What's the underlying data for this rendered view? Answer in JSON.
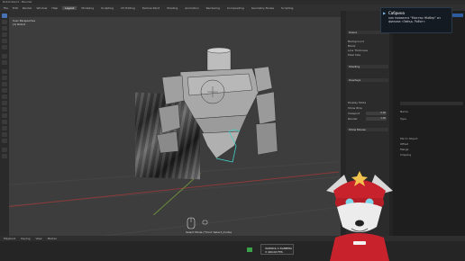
{
  "window": {
    "title": "Robot.blend - Blender"
  },
  "menu": {
    "items": [
      "File",
      "Edit",
      "Render",
      "Window",
      "Help"
    ],
    "tabs": [
      "Layout",
      "Modeling",
      "Sculpting",
      "UV Editing",
      "Texture Paint",
      "Shading",
      "Animation",
      "Rendering",
      "Compositing",
      "Geometry Nodes",
      "Scripting"
    ],
    "active_tab": "Layout"
  },
  "viewport": {
    "info_line1": "User Perspective",
    "info_line2": "(1) Robot",
    "status_text": "Select Mode (*mod: Select_mode)"
  },
  "properties": {
    "header": "Scene",
    "sections": [
      {
        "label": "Background",
        "value": ""
      },
      {
        "label": "Blank",
        "value": ""
      },
      {
        "label": "Line Thickness",
        "value": ""
      },
      {
        "label": "Pixel Size",
        "value": ""
      },
      {
        "label": "Shading",
        "value": ""
      },
      {
        "label": "Overlays",
        "value": ""
      },
      {
        "label": "Display Mode",
        "value": ""
      },
      {
        "label": "Show Wire",
        "value": ""
      },
      {
        "label": "Viewport",
        "value": "0.00"
      },
      {
        "label": "Render",
        "value": "1.00"
      },
      {
        "label": "Show Mouse",
        "value": ""
      }
    ]
  },
  "far_panel": {
    "rows": [
      "Name",
      "Type",
      "Mirror Object",
      "Offset",
      "Merge",
      "Clipping"
    ]
  },
  "notification": {
    "icon": "play-icon",
    "title": "Сабрина",
    "body": "как появился \"Мистер Жобер\" из фильма «Звёзд. Робот»"
  },
  "timeline": {
    "menu": [
      "Playback",
      "Keying",
      "View",
      "Marker"
    ],
    "frame_top": "ЗАПИСЬ С КАМЕРЫ",
    "frame_bottom": "3 400.00 FPS"
  },
  "colors": {
    "accent": "#4772b3",
    "selection_outline": "#3fd0c9",
    "notification_bg": "#141a22",
    "record_green": "#3aa34a"
  }
}
